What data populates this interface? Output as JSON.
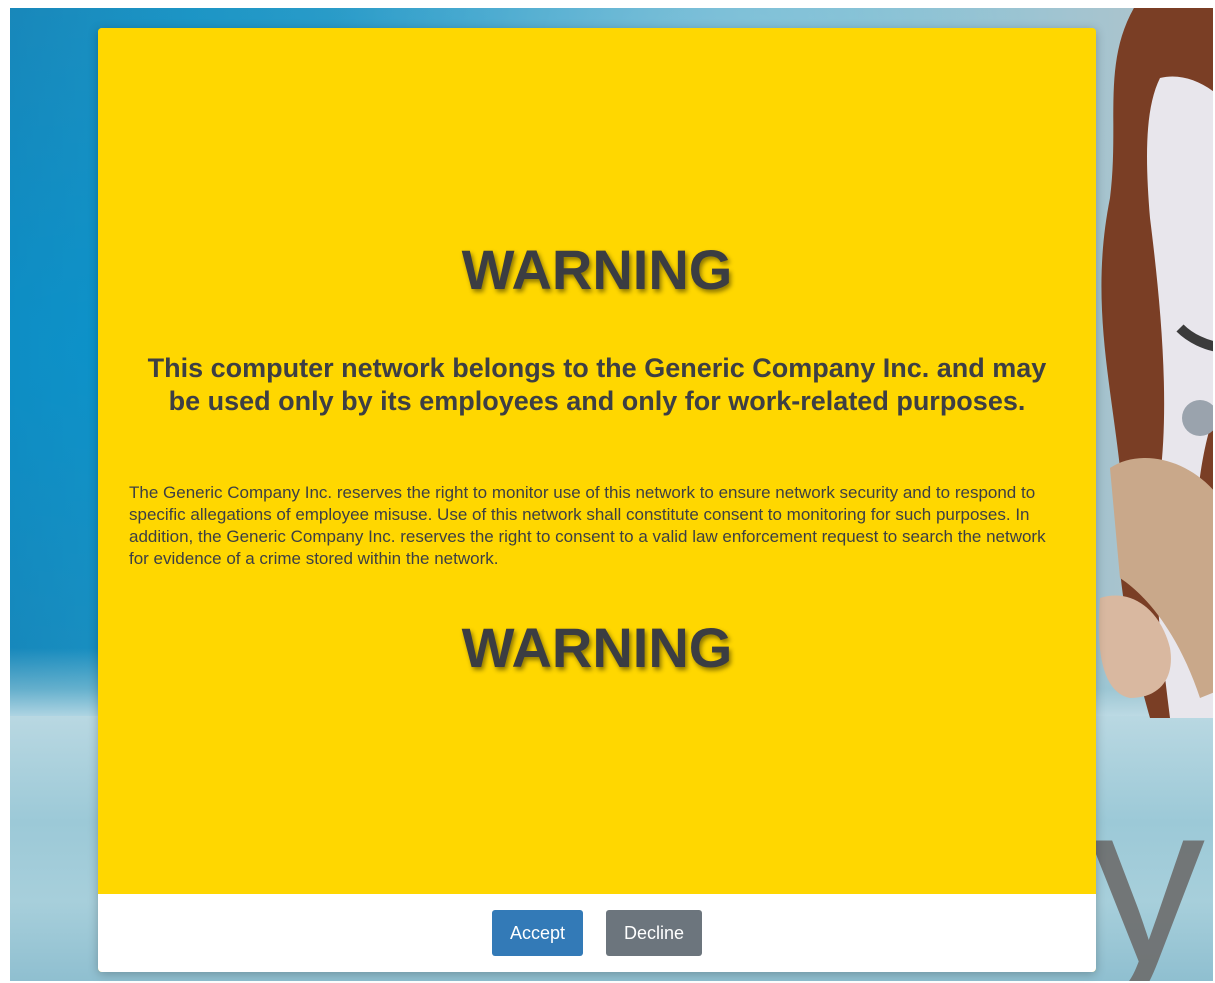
{
  "modal": {
    "heading_top": "WARNING",
    "headline": "This computer network belongs to the Generic Company Inc. and may be used only by its employees and only for work-related purposes.",
    "notice": "The Generic Company Inc. reserves the right to monitor use of this network to ensure network security and to respond to specific allegations of employee misuse. Use of this network shall constitute consent to monitoring for such purposes. In addition, the Generic Company Inc. reserves the right to consent to a valid law enforcement request to search the network for evidence of a crime stored within the network.",
    "heading_bottom": "WARNING",
    "accept_label": "Accept",
    "decline_label": "Decline"
  },
  "background": {
    "brand_partial": "y"
  },
  "colors": {
    "modal_background": "#ffd700",
    "text": "#3d3f44",
    "accept_button": "#337ab7",
    "decline_button": "#6c757d"
  }
}
